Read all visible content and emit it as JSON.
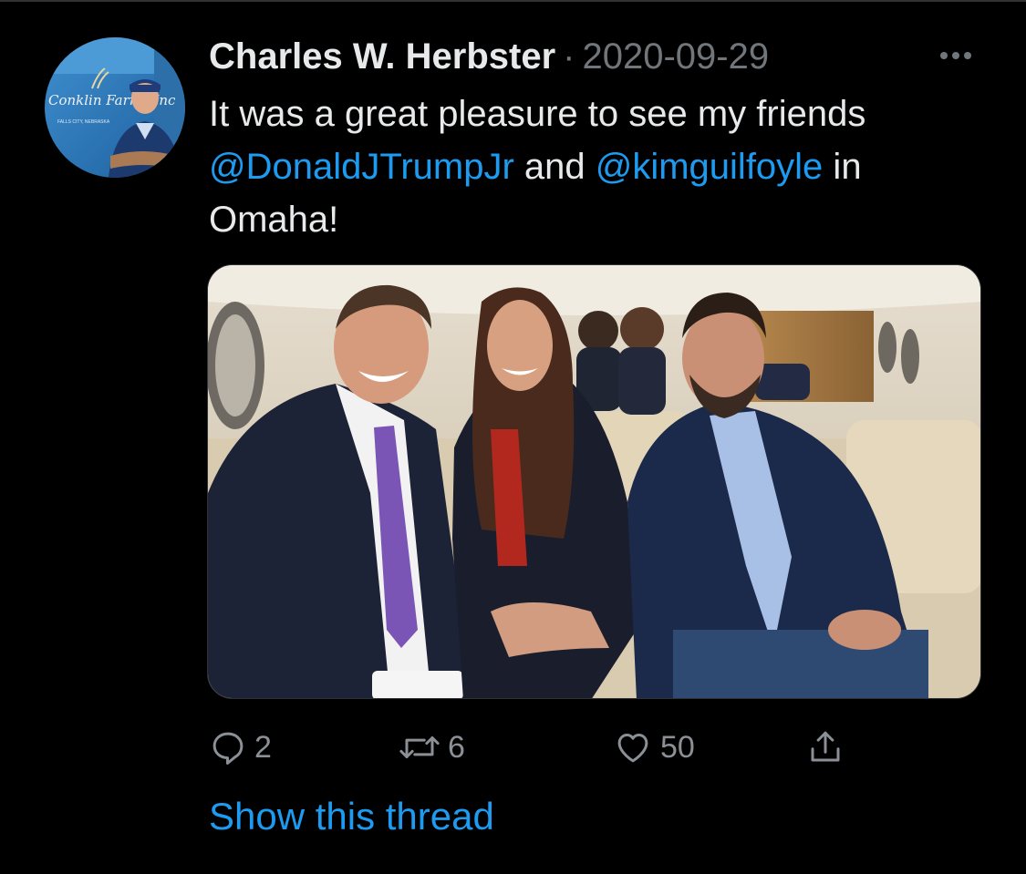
{
  "tweet": {
    "author_name": "Charles W. Herbster",
    "separator": "·",
    "date": "2020-09-29",
    "text_part_1": "It was a great pleasure to see my friends",
    "mention_1": "@DonaldJTrumpJr",
    "text_part_2": " and ",
    "mention_2": "@kimguilfoyle",
    "text_part_3": " in Omaha!",
    "avatar_banner_text": "Conklin Farms Inc",
    "avatar_location_text": "FALLS CITY, NEBRASKA"
  },
  "actions": {
    "reply_count": "2",
    "retweet_count": "6",
    "like_count": "50"
  },
  "thread": {
    "show_label": "Show this thread"
  },
  "icons": {
    "more": "more-horizontal-icon",
    "reply": "reply-icon",
    "retweet": "retweet-icon",
    "like": "heart-icon",
    "share": "share-icon"
  },
  "colors": {
    "background": "#000000",
    "text": "#e7e9ea",
    "muted": "#71767b",
    "accent": "#1d9bf0"
  }
}
